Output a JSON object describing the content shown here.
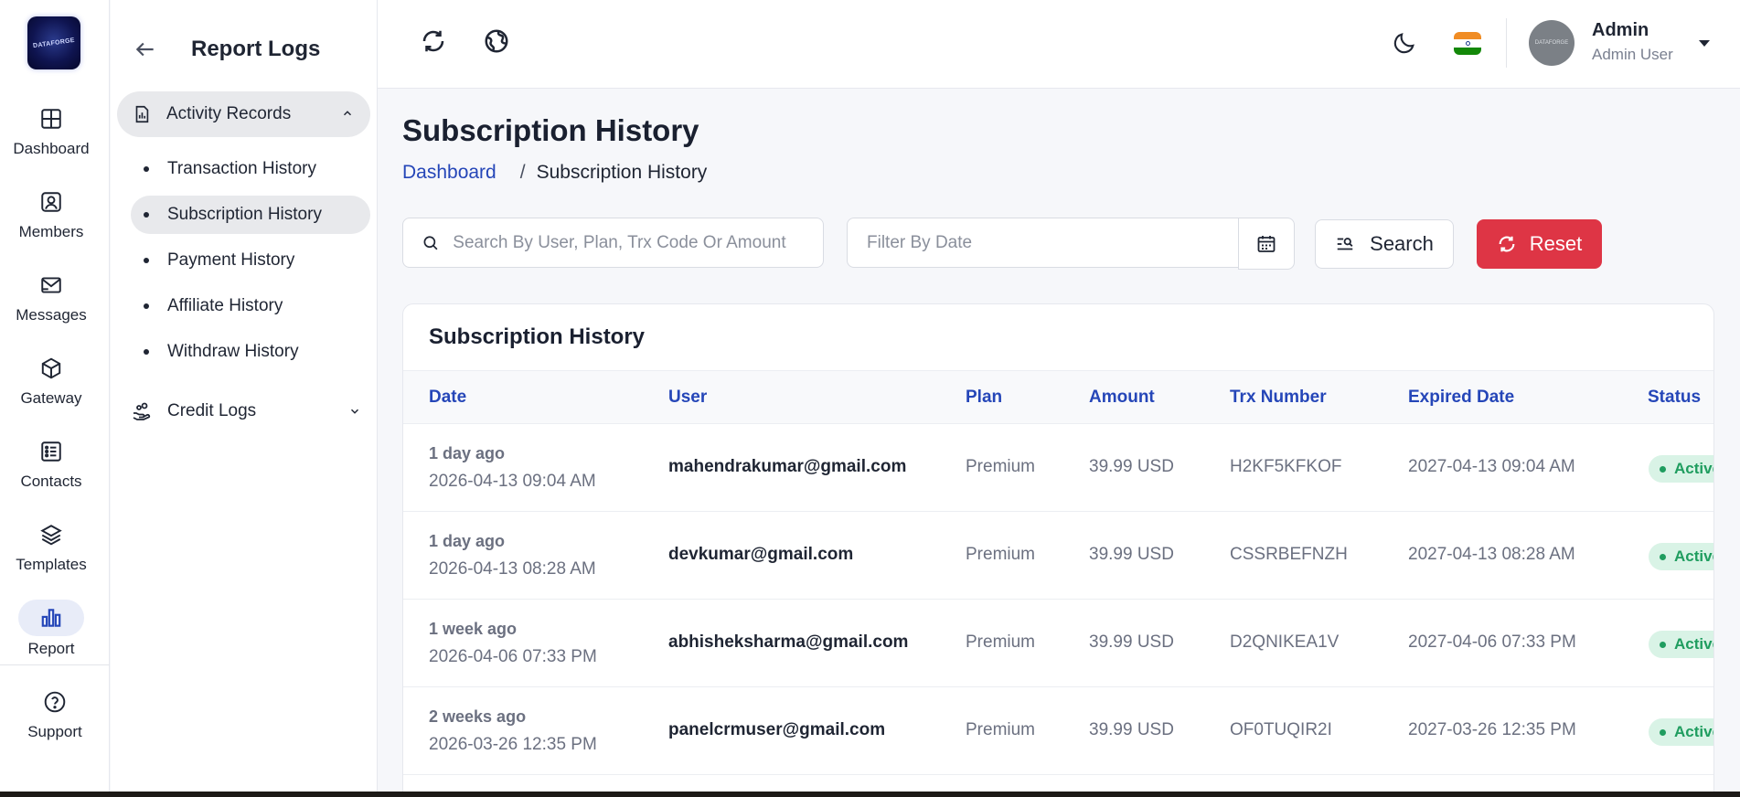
{
  "rail": {
    "items": [
      {
        "label": "Dashboard",
        "icon": "grid-icon"
      },
      {
        "label": "Members",
        "icon": "user-square-icon"
      },
      {
        "label": "Messages",
        "icon": "mail-icon"
      },
      {
        "label": "Gateway",
        "icon": "cube-icon"
      },
      {
        "label": "Contacts",
        "icon": "contacts-icon"
      },
      {
        "label": "Templates",
        "icon": "layers-icon"
      },
      {
        "label": "Report",
        "icon": "bar-chart-icon"
      },
      {
        "label": "Support",
        "icon": "help-icon"
      }
    ],
    "active": "Report"
  },
  "subnav": {
    "title": "Report Logs",
    "group1": "Activity Records",
    "items": [
      "Transaction History",
      "Subscription History",
      "Payment History",
      "Affiliate History",
      "Withdraw History"
    ],
    "active_item": "Subscription History",
    "group2": "Credit Logs"
  },
  "header": {
    "user_name": "Admin",
    "user_role": "Admin User",
    "flag_colors": [
      "#f08c24",
      "#ffffff",
      "#138808"
    ]
  },
  "page": {
    "title": "Subscription History",
    "breadcrumb_home": "Dashboard",
    "breadcrumb_sep": "/",
    "breadcrumb_current": "Subscription History"
  },
  "filters": {
    "search_placeholder": "Search By User, Plan, Trx Code Or Amount",
    "date_placeholder": "Filter By Date",
    "search_label": "Search",
    "reset_label": "Reset"
  },
  "table": {
    "title": "Subscription History",
    "columns": [
      "Date",
      "User",
      "Plan",
      "Amount",
      "Trx Number",
      "Expired Date",
      "Status"
    ],
    "rows": [
      {
        "ago": "1 day ago",
        "date": "2026-04-13 09:04 AM",
        "user": "mahendrakumar@gmail.com",
        "plan": "Premium",
        "amount": "39.99 USD",
        "trx": "H2KF5KFKOF",
        "expired": "2027-04-13 09:04 AM",
        "status": "Active"
      },
      {
        "ago": "1 day ago",
        "date": "2026-04-13 08:28 AM",
        "user": "devkumar@gmail.com",
        "plan": "Premium",
        "amount": "39.99 USD",
        "trx": "CSSRBEFNZH",
        "expired": "2027-04-13 08:28 AM",
        "status": "Active"
      },
      {
        "ago": "1 week ago",
        "date": "2026-04-06 07:33 PM",
        "user": "abhisheksharma@gmail.com",
        "plan": "Premium",
        "amount": "39.99 USD",
        "trx": "D2QNIKEA1V",
        "expired": "2027-04-06 07:33 PM",
        "status": "Active"
      },
      {
        "ago": "2 weeks ago",
        "date": "2026-03-26 12:35 PM",
        "user": "panelcrmuser@gmail.com",
        "plan": "Premium",
        "amount": "39.99 USD",
        "trx": "OF0TUQIR2I",
        "expired": "2027-03-26 12:35 PM",
        "status": "Active"
      }
    ]
  },
  "colors": {
    "accent": "#2546b8",
    "reset": "#de3545",
    "status_active_bg": "#d9f3e6",
    "status_active_fg": "#1f9d5f"
  }
}
